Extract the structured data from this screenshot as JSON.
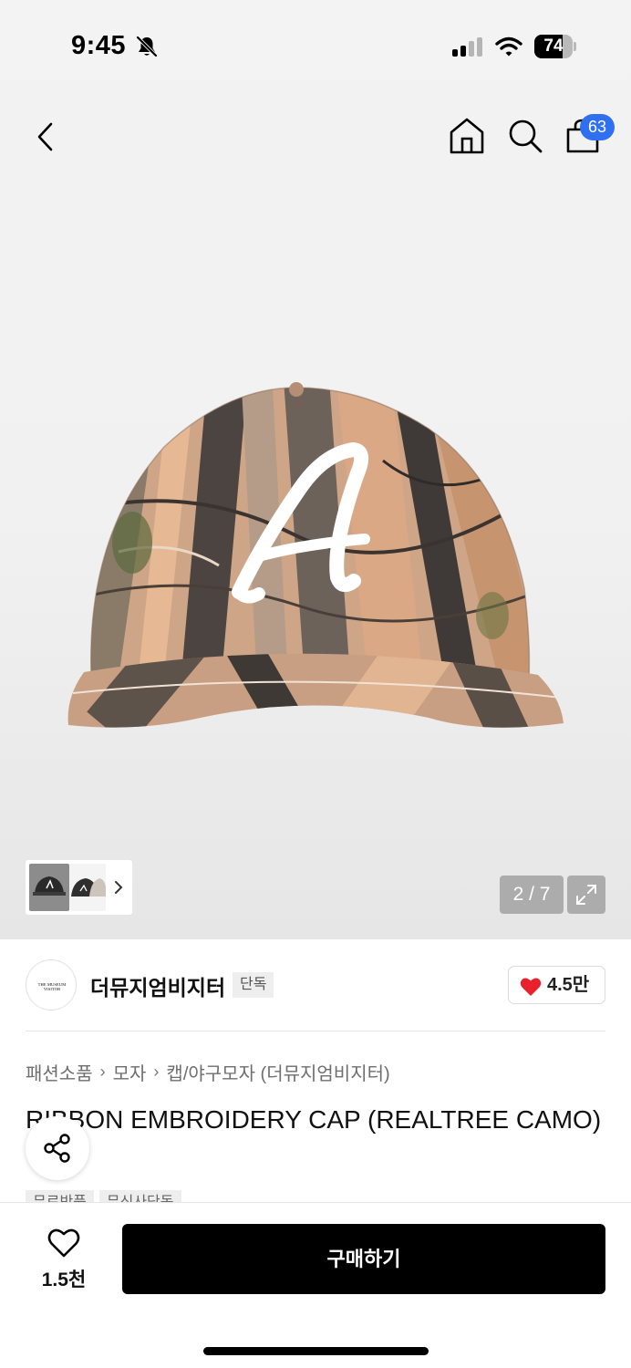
{
  "status_bar": {
    "time": "9:45",
    "battery": "74",
    "battery_level": 0.74
  },
  "header": {
    "cart_count": "63",
    "icons": [
      "back-icon",
      "home-icon",
      "search-icon",
      "cart-icon"
    ]
  },
  "gallery": {
    "counter": "2 / 7",
    "image_description_icon": "baseball-cap",
    "cap_letter": "A"
  },
  "brand": {
    "logo_text": "THE MUSEUM VISITOR",
    "name": "더뮤지엄비지터",
    "tag": "단독",
    "like_count": "4.5만"
  },
  "breadcrumb": [
    "패션소품",
    "모자",
    "캡/야구모자 (더뮤지엄비지터)"
  ],
  "product": {
    "title": "RIBBON EMBROIDERY CAP (REALTREE CAMO)",
    "chips": [
      "무료반품",
      "무신사단독"
    ]
  },
  "bottom_bar": {
    "wish_count": "1.5천",
    "buy_label": "구매하기"
  },
  "colors": {
    "accent_blue": "#2f6ff0",
    "heart_red": "#e8212d",
    "buy_button": "#000000"
  }
}
